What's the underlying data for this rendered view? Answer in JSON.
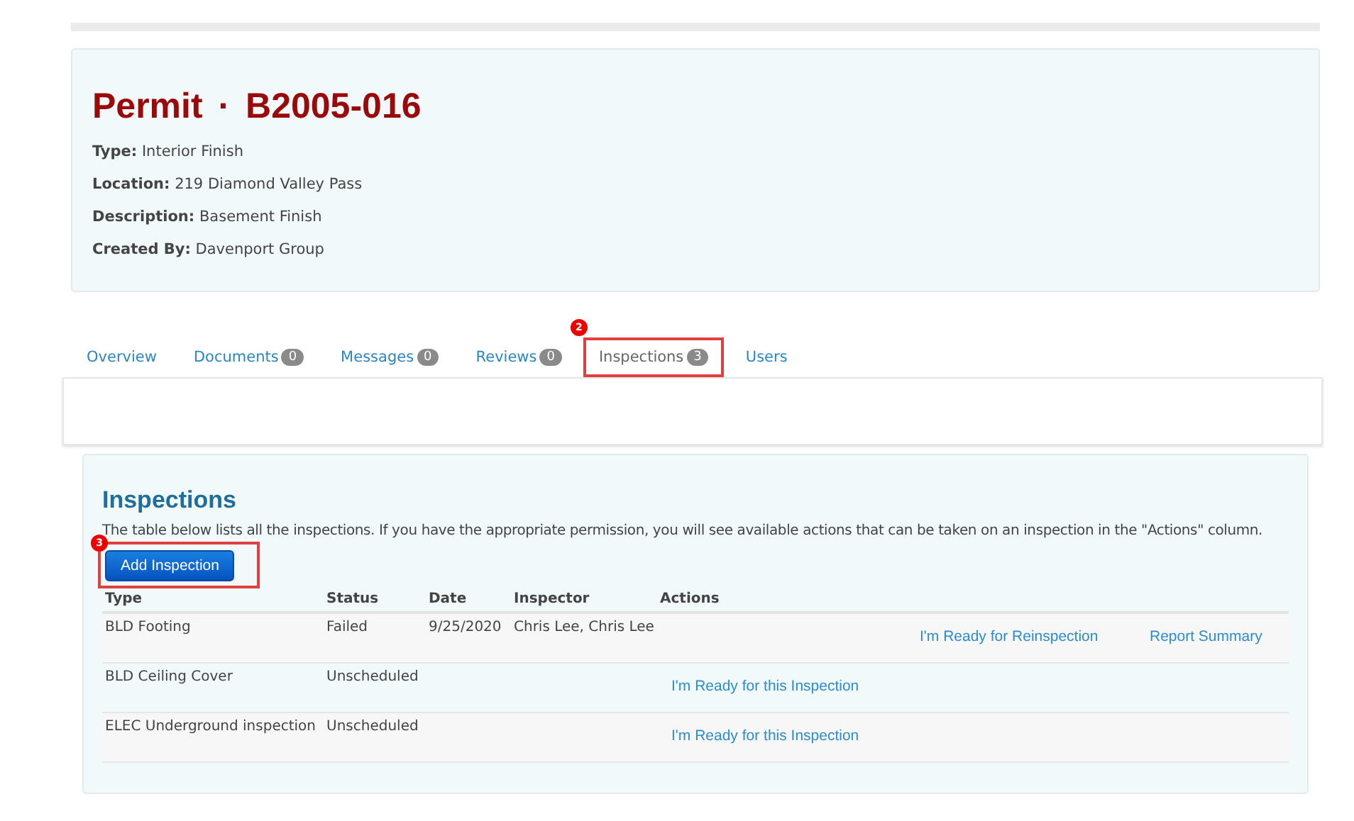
{
  "permit": {
    "title_prefix": "Permit",
    "title_separator": "·",
    "number": "B2005-016",
    "fields": [
      {
        "label": "Type:",
        "value": "Interior Finish"
      },
      {
        "label": "Location:",
        "value": "219 Diamond Valley Pass"
      },
      {
        "label": "Description:",
        "value": "Basement Finish"
      },
      {
        "label": "Created By:",
        "value": "Davenport Group"
      }
    ]
  },
  "tabs": [
    {
      "label": "Overview",
      "selected": false
    },
    {
      "label": "Documents",
      "count": "0",
      "selected": false
    },
    {
      "label": "Messages",
      "count": "0",
      "selected": false
    },
    {
      "label": "Reviews",
      "count": "0",
      "selected": false
    },
    {
      "label": "Inspections",
      "count": "3",
      "selected": true,
      "callout": "2"
    },
    {
      "label": "Users",
      "selected": false
    }
  ],
  "inspections": {
    "heading": "Inspections",
    "intro": "The table below lists all the inspections. If you have the appropriate permission, you will see available actions that can be taken on an inspection in the \"Actions\" column.",
    "add_button": {
      "label": "Add Inspection",
      "callout": "3"
    },
    "columns": [
      "Type",
      "Status",
      "Date",
      "Inspector",
      "Actions"
    ],
    "rows": [
      {
        "type": "BLD Footing",
        "status": "Failed",
        "date": "9/25/2020",
        "inspector": "Chris Lee, Chris Lee",
        "action_2": "I'm Ready for Reinspection",
        "action_3": "Report Summary"
      },
      {
        "type": "BLD Ceiling Cover",
        "status": "Unscheduled",
        "action_1": "I'm Ready for this Inspection"
      },
      {
        "type": "ELEC Underground inspection",
        "status": "Unscheduled",
        "action_1": "I'm Ready for this Inspection"
      }
    ]
  }
}
